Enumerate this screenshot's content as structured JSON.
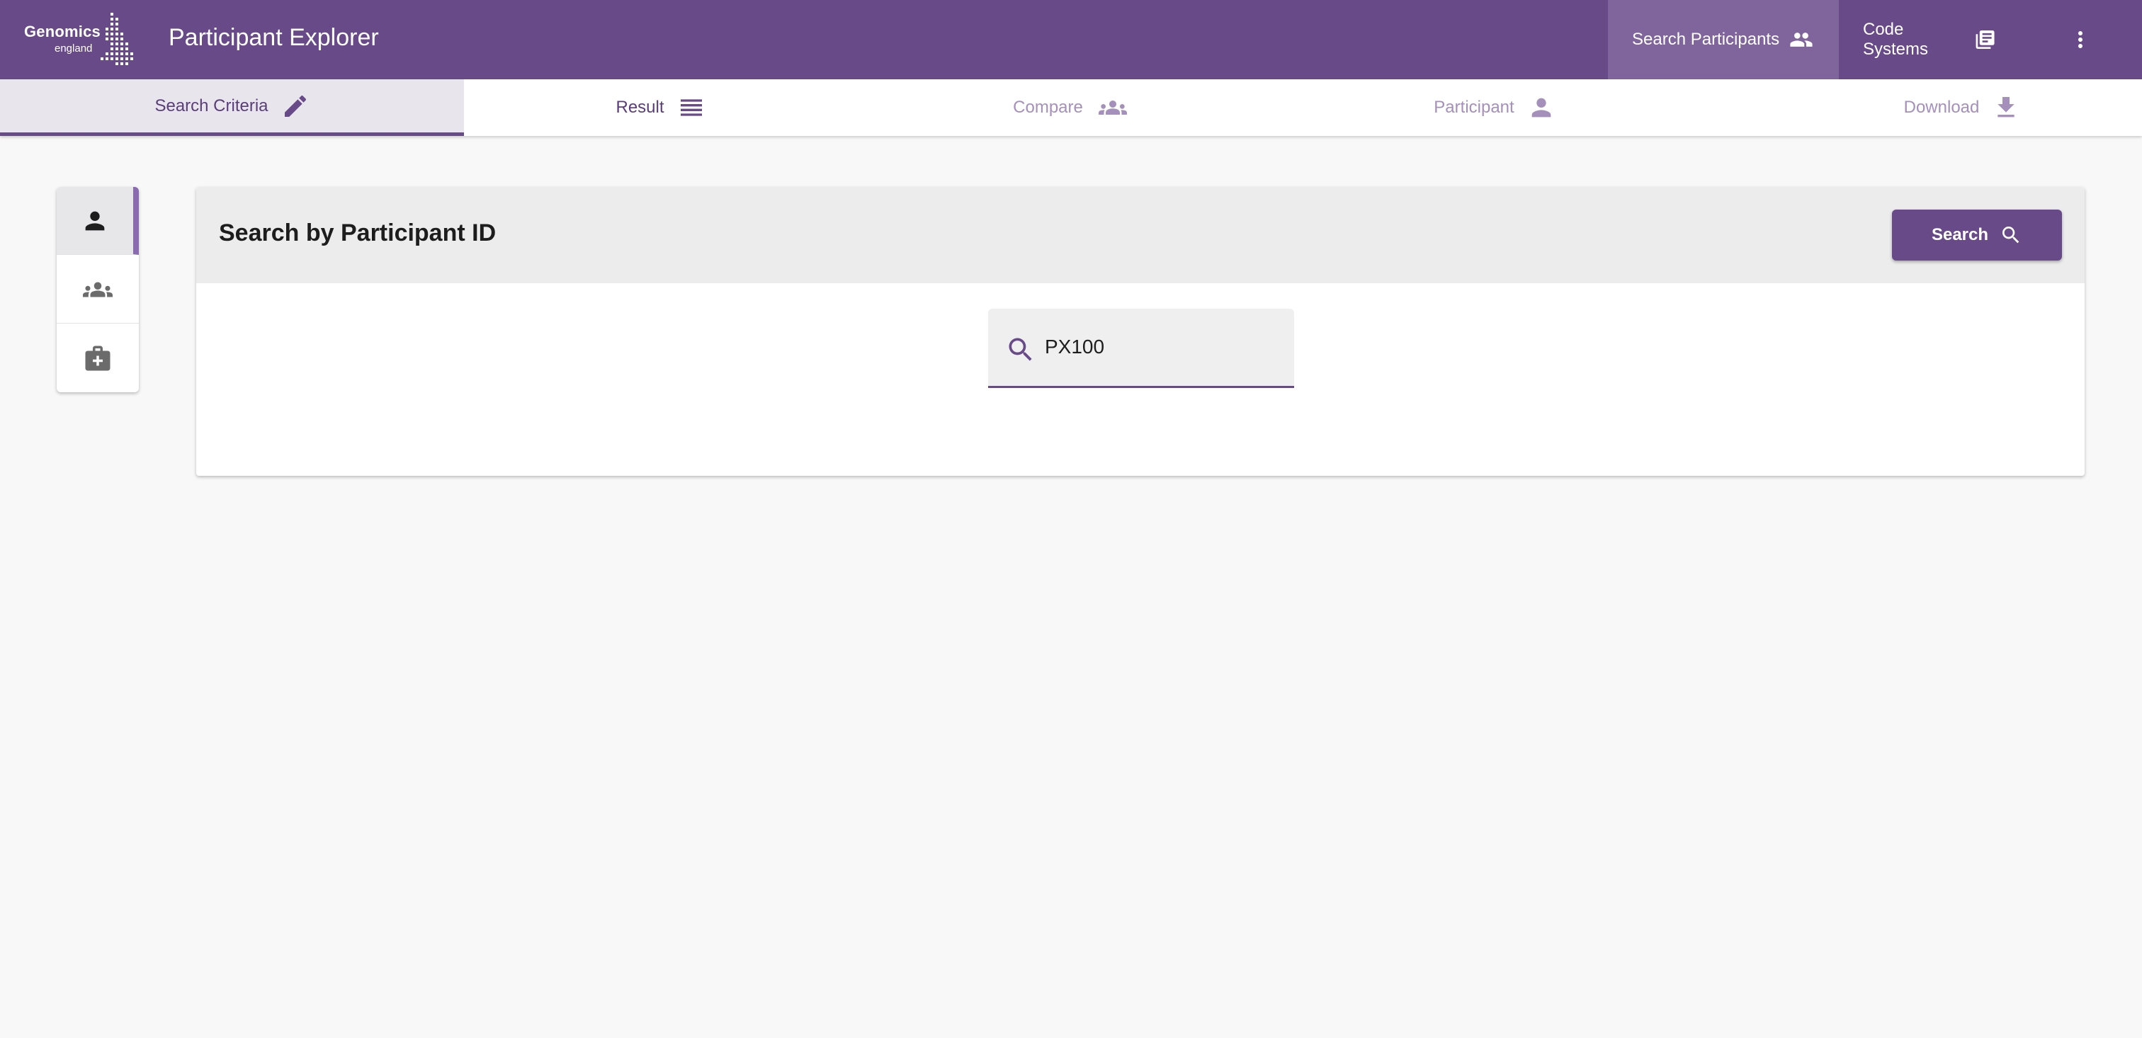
{
  "app": {
    "logo_line1": "Genomics",
    "logo_line2": "england",
    "title": "Participant Explorer"
  },
  "nav": {
    "search_participants": "Search Participants",
    "code_systems": "Code Systems",
    "more_icon": "more-vert-icon"
  },
  "tabs": [
    {
      "label": "Search Criteria",
      "icon": "pencil-icon",
      "state": "selected"
    },
    {
      "label": "Result",
      "icon": "list-icon",
      "state": "done"
    },
    {
      "label": "Compare",
      "icon": "group-icon",
      "state": "disabled"
    },
    {
      "label": "Participant",
      "icon": "person-icon",
      "state": "disabled"
    },
    {
      "label": "Download",
      "icon": "download-icon",
      "state": "disabled"
    }
  ],
  "side_panel": {
    "items": [
      {
        "icon": "person-icon",
        "active": true
      },
      {
        "icon": "group-icon",
        "active": false
      },
      {
        "icon": "medical-bag-icon",
        "active": false
      }
    ]
  },
  "card": {
    "title": "Search by Participant ID",
    "search_button": "Search",
    "input_value": "PX100"
  },
  "colors": {
    "brand": "#684a88",
    "brand_light": "#7f659b",
    "tab_disabled": "#a590bb"
  }
}
